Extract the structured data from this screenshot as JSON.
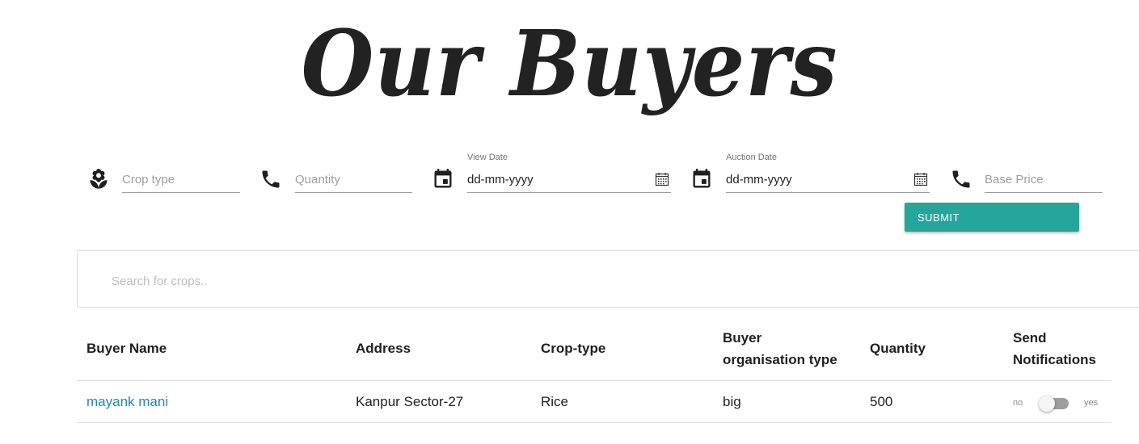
{
  "page": {
    "title": "Our Buyers"
  },
  "form": {
    "crop_type": {
      "placeholder": "Crop type",
      "icon": "flower-icon"
    },
    "quantity": {
      "placeholder": "Quantity",
      "icon": "phone-icon"
    },
    "view_date": {
      "label": "View Date",
      "value": "dd-mm-yyyy",
      "icon": "event-icon"
    },
    "auction_date": {
      "label": "Auction Date",
      "value": "dd-mm-yyyy",
      "icon": "event-icon"
    },
    "base_price": {
      "placeholder": "Base Price",
      "icon": "phone-icon"
    },
    "submit_label": "SUBMIT",
    "accent_color": "#26a69a"
  },
  "search": {
    "placeholder": "Search for crops.."
  },
  "table": {
    "headers": {
      "buyer_name": "Buyer Name",
      "address": "Address",
      "crop_type": "Crop-type",
      "org_type_line1": "Buyer",
      "org_type_line2": "organisation type",
      "quantity": "Quantity",
      "notify_line1": "Send",
      "notify_line2": "Notifications"
    },
    "rows": [
      {
        "buyer_name": "mayank mani",
        "address": "Kanpur Sector-27",
        "crop_type": "Rice",
        "org_type": "big",
        "quantity": "500",
        "toggle_off_label": "no",
        "toggle_on_label": "yes"
      }
    ]
  }
}
